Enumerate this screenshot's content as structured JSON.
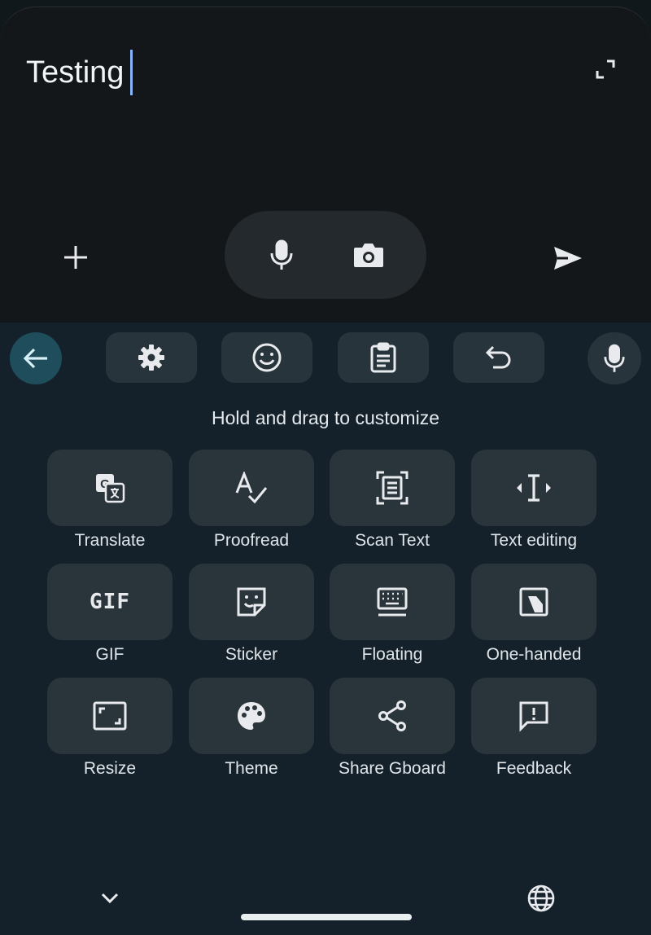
{
  "compose": {
    "text": "Testing"
  },
  "icons": {
    "expand": "expand-icon",
    "add": "plus-icon",
    "mic": "mic-icon",
    "camera": "camera-icon",
    "send": "send-icon",
    "back": "arrow-back-icon",
    "settings": "gear-icon",
    "emoji": "emoji-icon",
    "clipboard": "clipboard-icon",
    "undo": "undo-icon",
    "collapse": "chevron-down-icon",
    "language": "globe-icon"
  },
  "keyboard": {
    "hint": "Hold and drag to customize",
    "tiles": [
      {
        "label": "Translate",
        "icon": "translate-icon"
      },
      {
        "label": "Proofread",
        "icon": "proofread-icon"
      },
      {
        "label": "Scan Text",
        "icon": "scan-text-icon"
      },
      {
        "label": "Text editing",
        "icon": "text-editing-icon"
      },
      {
        "label": "GIF",
        "icon": "gif-icon",
        "glyph": "GIF"
      },
      {
        "label": "Sticker",
        "icon": "sticker-icon"
      },
      {
        "label": "Floating",
        "icon": "floating-keyboard-icon"
      },
      {
        "label": "One-handed",
        "icon": "one-handed-icon"
      },
      {
        "label": "Resize",
        "icon": "resize-icon"
      },
      {
        "label": "Theme",
        "icon": "palette-icon"
      },
      {
        "label": "Share Gboard",
        "icon": "share-icon"
      },
      {
        "label": "Feedback",
        "icon": "feedback-icon"
      }
    ]
  },
  "colors": {
    "accent": "#8ab4f8",
    "back_button_bg": "#1f4d5c",
    "tile_bg": "#2a353b",
    "panel_bg": "#14202a"
  }
}
